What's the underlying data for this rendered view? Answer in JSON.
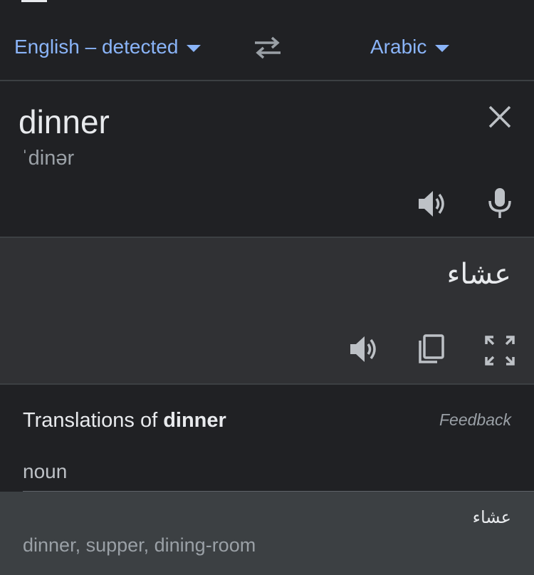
{
  "source_lang": {
    "label": "English – detected"
  },
  "target_lang": {
    "label": "Arabic"
  },
  "source": {
    "text": "dinner",
    "phonetic": "ˈdinər"
  },
  "target": {
    "text": "عشاء"
  },
  "translations": {
    "title_prefix": "Translations of",
    "title_word": "dinner",
    "feedback": "Feedback",
    "part_of_speech": "noun",
    "entries": [
      {
        "word": "عشاء",
        "synonyms": "dinner, supper, dining-room"
      }
    ]
  },
  "colors": {
    "accent": "#8ab4f8",
    "background": "#202124",
    "panel": "#303134",
    "highlight": "#3c4043"
  },
  "icons": [
    "swap-languages-icon",
    "clear-icon",
    "speaker-icon",
    "microphone-icon",
    "copy-icon",
    "fullscreen-icon",
    "chevron-down-icon"
  ]
}
